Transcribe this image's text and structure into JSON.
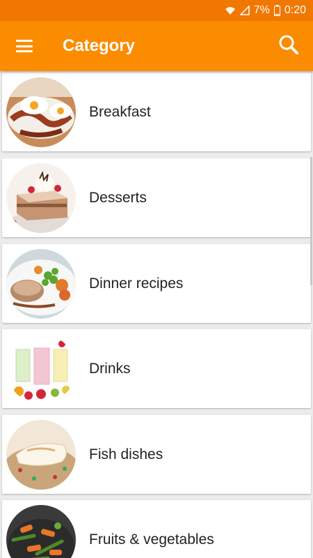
{
  "status_bar": {
    "battery": "7%",
    "time": "0:20",
    "icons": [
      "wifi-icon",
      "signal-icon",
      "battery-icon"
    ]
  },
  "app_bar": {
    "title": "Category",
    "menu_icon": "hamburger-menu-icon",
    "search_icon": "search-icon",
    "color": "#fb8c00"
  },
  "categories": [
    {
      "label": "Breakfast"
    },
    {
      "label": "Desserts"
    },
    {
      "label": "Dinner recipes"
    },
    {
      "label": "Drinks"
    },
    {
      "label": "Fish dishes"
    },
    {
      "label": "Fruits & vegetables"
    }
  ]
}
